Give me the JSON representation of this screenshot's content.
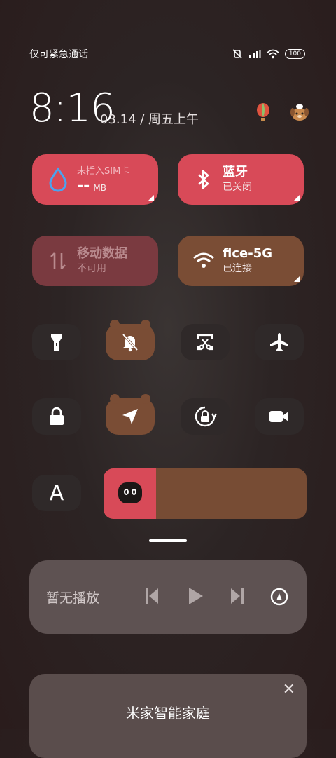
{
  "status_bar": {
    "carrier_text": "仅可紧急通话",
    "battery": "100",
    "icons": [
      "silent-icon",
      "signal-icon",
      "wifi-icon",
      "battery-icon"
    ]
  },
  "header": {
    "time": "8:16",
    "date": "03.14 / 周五上午",
    "icons": [
      "balloon-icon",
      "dog-avatar-icon"
    ]
  },
  "tiles": {
    "data_usage": {
      "title": "未插入SIM卡",
      "value": "--",
      "unit": "MB",
      "color": "#d84a58"
    },
    "bluetooth": {
      "title": "蓝牙",
      "status": "已关闭",
      "color": "#d84a58"
    },
    "mobile_data": {
      "title": "移动数据",
      "status": "不可用",
      "color": "#7a3a40"
    },
    "wifi": {
      "title": "fice-5G",
      "status": "已连接",
      "color": "#7a4d35"
    }
  },
  "toggles": {
    "row1": [
      "flashlight-icon",
      "mute-bell-icon",
      "screenshot-icon",
      "airplane-icon"
    ],
    "row2": [
      "lock-icon",
      "location-icon",
      "rotation-lock-icon",
      "video-icon"
    ],
    "font_button": "A"
  },
  "brightness": {
    "level": 0.26,
    "accent": "#d84a58",
    "track": "#774c34"
  },
  "media": {
    "label": "暂无播放",
    "controls": [
      "previous-icon",
      "play-icon",
      "next-icon",
      "cast-icon"
    ]
  },
  "smart_home": {
    "title": "米家智能家庭",
    "close": "✕"
  }
}
